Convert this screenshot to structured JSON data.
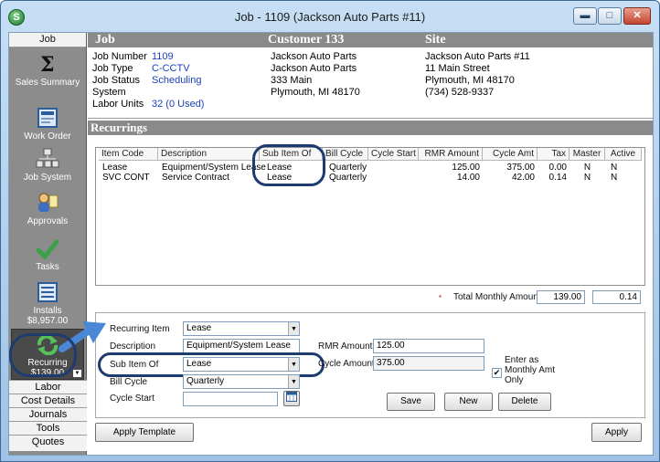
{
  "window": {
    "title": "Job - 1109 (Jackson Auto Parts #11)",
    "app_icon": "S",
    "minimize": "▬",
    "maximize": "□",
    "close": "✕"
  },
  "sidebar": {
    "top_tab": "Job",
    "items": [
      {
        "label": "Sales Summary",
        "icon": "sigma-icon"
      },
      {
        "label": "Work Order",
        "icon": "work-order-icon"
      },
      {
        "label": "Job System",
        "icon": "job-system-icon"
      },
      {
        "label": "Approvals",
        "icon": "approvals-icon"
      },
      {
        "label": "Tasks",
        "icon": "check-icon"
      },
      {
        "label": "Installs",
        "amount": "$8,957.00",
        "icon": "installs-icon"
      },
      {
        "label": "Recurring",
        "amount": "$139.00",
        "icon": "recurring-icon"
      }
    ],
    "bottom_tabs": [
      "Labor",
      "Cost Details",
      "Journals",
      "Tools",
      "Quotes"
    ]
  },
  "header": {
    "col_job": "Job",
    "col_customer": "Customer 133",
    "col_site": "Site",
    "job_fields": [
      {
        "label": "Job Number",
        "value": "1109"
      },
      {
        "label": "Job Type",
        "value": "C-CCTV"
      },
      {
        "label": "Job Status",
        "value": "Scheduling"
      },
      {
        "label": "System",
        "value": ""
      },
      {
        "label": "Labor Units",
        "value": "32 (0 Used)"
      }
    ],
    "customer_lines": [
      "Jackson Auto Parts",
      "Jackson Auto Parts",
      "333 Main",
      "Plymouth, MI  48170"
    ],
    "site_lines": [
      "Jackson Auto Parts #11",
      "11 Main Street",
      "Plymouth, MI  48170",
      "(734) 528-9337"
    ]
  },
  "recurrings": {
    "section_title": "Recurrings",
    "columns": [
      "Item Code",
      "Description",
      "Sub Item Of",
      "Bill Cycle",
      "Cycle Start",
      "RMR Amount",
      "Cycle Amt",
      "Tax",
      "Master",
      "Active"
    ],
    "rows": [
      [
        "Lease",
        "Equipment/System Lease",
        "Lease",
        "Quarterly",
        "",
        "125.00",
        "375.00",
        "0.00",
        "N",
        "N"
      ],
      [
        "SVC CONT",
        "Service Contract",
        "Lease",
        "Quarterly",
        "",
        "14.00",
        "42.00",
        "0.14",
        "N",
        "N"
      ]
    ],
    "total_label": "Total Monthly Amount",
    "total_value": "139.00",
    "total_tax": "0.14"
  },
  "form": {
    "recurring_item_label": "Recurring Item",
    "recurring_item_value": "Lease",
    "description_label": "Description",
    "description_value": "Equipment/System Lease",
    "sub_item_label": "Sub Item Of",
    "sub_item_value": "Lease",
    "bill_cycle_label": "Bill Cycle",
    "bill_cycle_value": "Quarterly",
    "cycle_start_label": "Cycle Start",
    "cycle_start_value": "",
    "rmr_label": "RMR Amount",
    "rmr_value": "125.00",
    "cycle_amount_label": "Cycle Amount",
    "cycle_amount_value": "375.00",
    "enter_monthly_label": "Enter as Monthly Amt Only",
    "enter_monthly_checked": "✔",
    "save": "Save",
    "new": "New",
    "delete": "Delete"
  },
  "footer": {
    "apply_template": "Apply Template",
    "apply": "Apply"
  },
  "colors": {
    "accent_oval": "#1d3b6e",
    "arrow": "#4a87d6",
    "link_blue": "#1a3fbd"
  }
}
